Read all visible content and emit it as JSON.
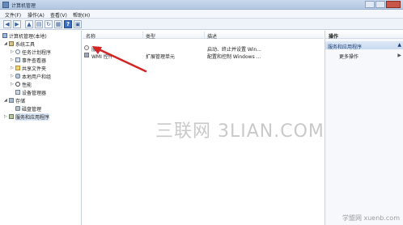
{
  "window": {
    "title": "计算机管理"
  },
  "menubar": {
    "items": [
      "文件(F)",
      "操作(A)",
      "查看(V)",
      "帮助(H)"
    ]
  },
  "toolbar": {
    "buttons": [
      {
        "icon": "back-arrow-icon",
        "glyph": "◀"
      },
      {
        "icon": "forward-arrow-icon",
        "glyph": "▶"
      },
      {
        "icon": "up-folder-icon",
        "glyph": "▲"
      },
      {
        "icon": "show-hide-tree-icon",
        "glyph": "▤"
      },
      {
        "icon": "refresh-icon",
        "glyph": "↻"
      },
      {
        "icon": "export-list-icon",
        "glyph": "▦"
      },
      {
        "icon": "help-icon",
        "glyph": "?"
      },
      {
        "icon": "properties-icon",
        "glyph": "▣"
      }
    ]
  },
  "tree": {
    "root": "计算机管理(本地)",
    "system_tools": "系统工具",
    "task_scheduler": "任务计划程序",
    "event_viewer": "事件查看器",
    "shared_folders": "共享文件夹",
    "local_users": "本地用户和组",
    "performance": "性能",
    "device_manager": "设备管理器",
    "storage": "存储",
    "disk_management": "磁盘管理",
    "services_apps": "服务和应用程序"
  },
  "list": {
    "columns": [
      "名称",
      "类型",
      "描述"
    ],
    "rows": [
      {
        "name": "服务",
        "type": "",
        "description": "启动、终止并设置 Win..."
      },
      {
        "name": "WMI 控件",
        "type": "扩展管理单元",
        "description": "配置和控制 Windows ..."
      }
    ]
  },
  "actions": {
    "header": "操作",
    "section": "服务和应用程序",
    "more": "更多操作"
  },
  "watermark": "三联网 3LIAN.COM",
  "corner_watermark": "学盟网 xuenb.com",
  "colors": {
    "accent": "#1d3f73",
    "arrow": "#d42424"
  }
}
